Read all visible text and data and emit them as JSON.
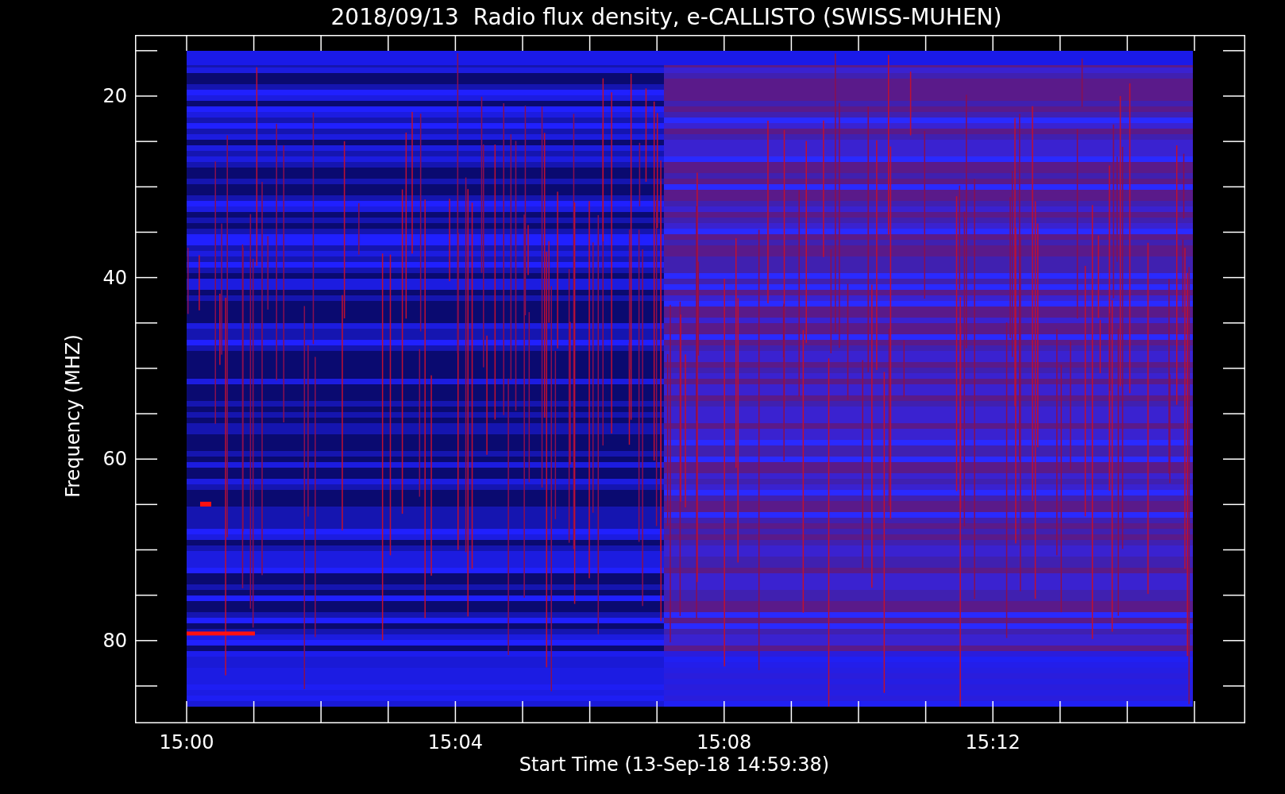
{
  "title": "2018/09/13  Radio flux density, e-CALLISTO (SWISS-MUHEN)",
  "y_axis": {
    "label": "Frequency (MHZ)",
    "ticks": [
      "20",
      "40",
      "60",
      "80"
    ]
  },
  "x_axis": {
    "label": "Start Time (13-Sep-18 14:59:38)",
    "ticks": [
      "15:00",
      "15:04",
      "15:08",
      "15:12"
    ]
  }
}
